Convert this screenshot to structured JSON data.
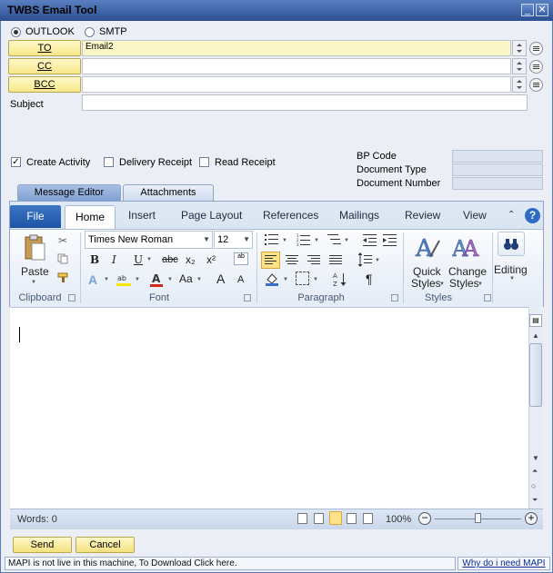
{
  "window": {
    "title": "TWBS Email Tool",
    "minimize": "_",
    "close": "✕"
  },
  "mode": {
    "outlook": "OUTLOOK",
    "smtp": "SMTP",
    "selected": "OUTLOOK"
  },
  "address": {
    "to_label": "TO",
    "to_value": "Email2",
    "cc_label": "CC",
    "cc_value": "",
    "bcc_label": "BCC",
    "bcc_value": ""
  },
  "subject": {
    "label": "Subject",
    "value": ""
  },
  "options": {
    "create_activity": "Create Activity",
    "create_activity_checked": true,
    "delivery_receipt": "Delivery Receipt",
    "read_receipt": "Read Receipt"
  },
  "bp": {
    "bp_code": "BP Code",
    "document_type": "Document Type",
    "document_number": "Document Number"
  },
  "tabs": {
    "message_editor": "Message Editor",
    "attachments": "Attachments"
  },
  "ribbon": {
    "tabs": [
      "File",
      "Home",
      "Insert",
      "Page Layout",
      "References",
      "Mailings",
      "Review",
      "View"
    ],
    "clipboard": {
      "paste": "Paste",
      "group": "Clipboard"
    },
    "font": {
      "name": "Times New Roman",
      "size": "12",
      "group": "Font",
      "bold": "B",
      "italic": "I",
      "underline": "U",
      "strike": "abc",
      "sub": "x₂",
      "sup": "x²",
      "grow": "A",
      "shrink": "A",
      "case": "Aa"
    },
    "paragraph": {
      "group": "Paragraph",
      "pilcrow": "¶"
    },
    "styles": {
      "quick_line1": "Quick",
      "quick_line2": "Styles",
      "change_line1": "Change",
      "change_line2": "Styles",
      "group": "Styles"
    },
    "editing": {
      "label": "Editing"
    }
  },
  "status": {
    "words": "Words: 0",
    "zoom": "100%",
    "zoom_minus": "−",
    "zoom_plus": "+"
  },
  "buttons": {
    "send": "Send",
    "cancel": "Cancel"
  },
  "footer": {
    "message": "MAPI is not live in this machine, To Download Click here.",
    "link": "Why do i need MAPI"
  }
}
